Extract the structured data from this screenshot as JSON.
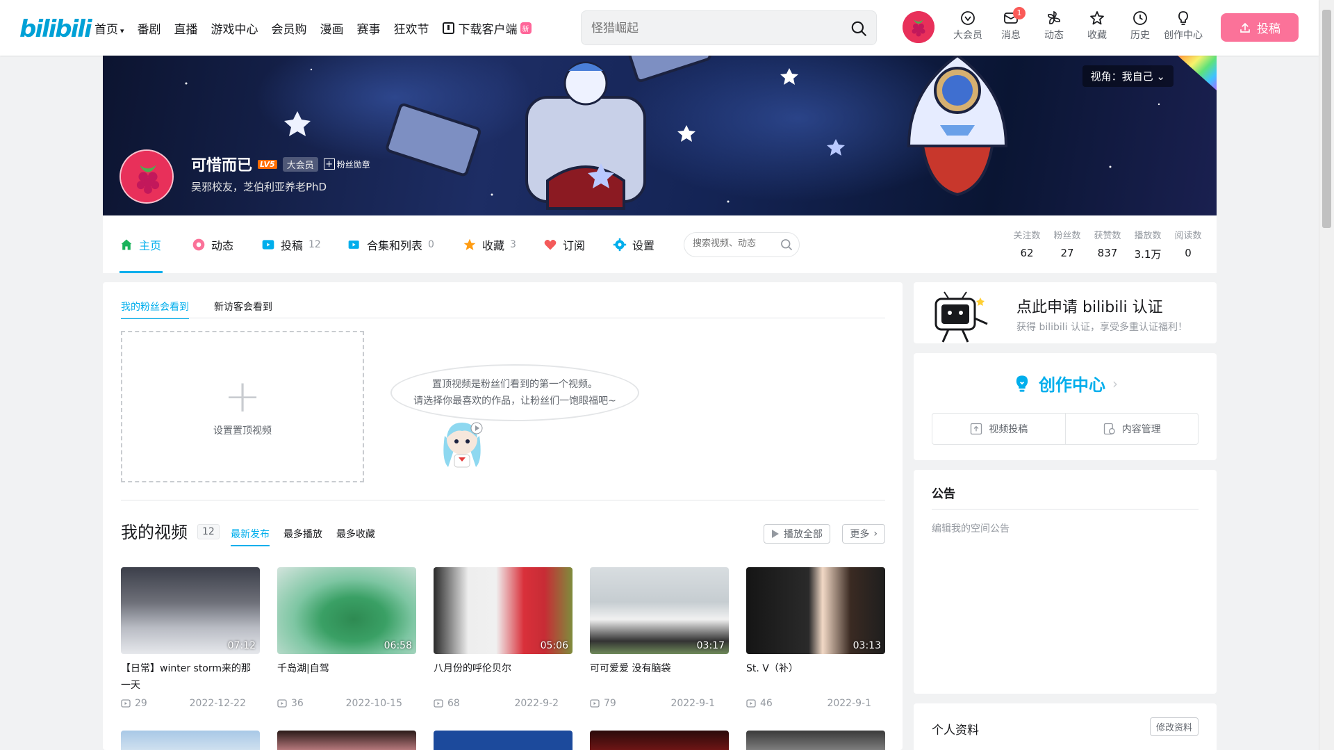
{
  "header": {
    "logo": "bilibili",
    "nav": [
      "首页",
      "番剧",
      "直播",
      "游戏中心",
      "会员购",
      "漫画",
      "赛事",
      "狂欢节"
    ],
    "download": "下载客户端",
    "download_badge": "新",
    "search_placeholder": "怪猎崛起",
    "right_items": [
      {
        "label": "大会员",
        "icon": "vip-icon"
      },
      {
        "label": "消息",
        "icon": "message-icon",
        "badge": "1"
      },
      {
        "label": "动态",
        "icon": "dynamic-icon"
      },
      {
        "label": "收藏",
        "icon": "star-icon"
      },
      {
        "label": "历史",
        "icon": "history-icon"
      },
      {
        "label": "创作中心",
        "icon": "bulb-icon"
      }
    ],
    "upload": "投稿"
  },
  "banner": {
    "viewpoint": "视角：我自己",
    "name": "可惜而已",
    "level": "LV5",
    "vip": "大会员",
    "fan_badge": "粉丝勋章",
    "sign": "吴邪校友，芝伯利亚养老PhD"
  },
  "tabs": {
    "items": [
      {
        "label": "主页",
        "count": ""
      },
      {
        "label": "动态",
        "count": ""
      },
      {
        "label": "投稿",
        "count": "12"
      },
      {
        "label": "合集和列表",
        "count": "0"
      },
      {
        "label": "收藏",
        "count": "3"
      },
      {
        "label": "订阅",
        "count": ""
      },
      {
        "label": "设置",
        "count": ""
      }
    ],
    "search_placeholder": "搜索视频、动态",
    "stats": [
      {
        "label": "关注数",
        "value": "62"
      },
      {
        "label": "粉丝数",
        "value": "27"
      },
      {
        "label": "获赞数",
        "value": "837"
      },
      {
        "label": "播放数",
        "value": "3.1万"
      },
      {
        "label": "阅读数",
        "value": "0"
      }
    ]
  },
  "main": {
    "sub_tabs": [
      "我的粉丝会看到",
      "新访客会看到"
    ],
    "pin_label": "设置置顶视频",
    "bubble_line1": "置顶视频是粉丝们看到的第一个视频。",
    "bubble_line2": "请选择你最喜欢的作品，让粉丝们一饱眼福吧~",
    "videos_title": "我的视频",
    "videos_count": "12",
    "sort_tabs": [
      "最新发布",
      "最多播放",
      "最多收藏"
    ],
    "play_all": "播放全部",
    "more": "更多",
    "videos": [
      {
        "title": "【日常】winter storm来的那一天",
        "duration": "07:12",
        "plays": "29",
        "date": "2022-12-22"
      },
      {
        "title": "千岛湖|自驾",
        "duration": "06:58",
        "plays": "36",
        "date": "2022-10-15"
      },
      {
        "title": "八月份的呼伦贝尔",
        "duration": "05:06",
        "plays": "68",
        "date": "2022-9-2"
      },
      {
        "title": "可可爱爱 没有脑袋",
        "duration": "03:17",
        "plays": "79",
        "date": "2022-9-1"
      },
      {
        "title": "St. V（补）",
        "duration": "03:13",
        "plays": "46",
        "date": "2022-9-1"
      }
    ]
  },
  "sidebar": {
    "cert_title": "点此申请 bilibili 认证",
    "cert_sub": "获得 bilibili 认证，享受多重认证福利！",
    "creator_title": "创作中心",
    "creator_btns": [
      "视频投稿",
      "内容管理"
    ],
    "notice_title": "公告",
    "notice_text": "编辑我的空间公告",
    "profile_title": "个人资料",
    "profile_edit": "修改资料"
  },
  "colors": {
    "brand_blue": "#00aeec",
    "brand_pink": "#fb7299"
  }
}
